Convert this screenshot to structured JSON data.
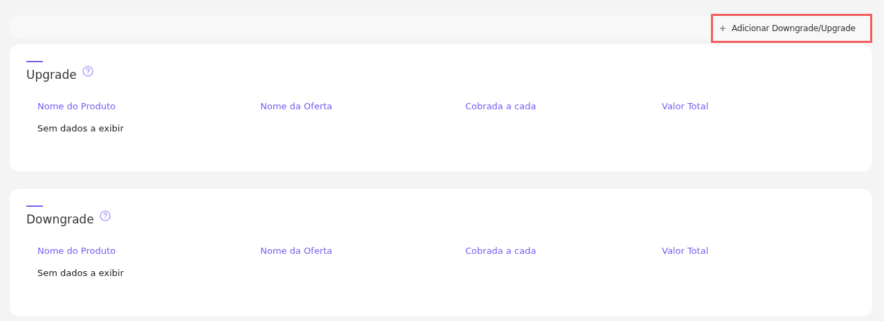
{
  "toolbar": {
    "add_button": "Adicionar Downgrade/Upgrade"
  },
  "sections": [
    {
      "title": "Upgrade",
      "columns": [
        "Nome do Produto",
        "Nome da Oferta",
        "Cobrada a cada",
        "Valor Total"
      ],
      "empty_message": "Sem dados a exibir"
    },
    {
      "title": "Downgrade",
      "columns": [
        "Nome do Produto",
        "Nome da Oferta",
        "Cobrada a cada",
        "Valor Total"
      ],
      "empty_message": "Sem dados a exibir"
    }
  ]
}
